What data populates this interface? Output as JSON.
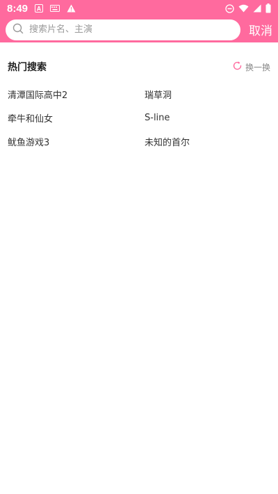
{
  "status_bar": {
    "time": "8:49",
    "icons": [
      "text-a-icon",
      "keyboard-icon",
      "warning-icon",
      "do-not-disturb-icon",
      "wifi-icon",
      "signal-icon",
      "battery-icon"
    ]
  },
  "search": {
    "placeholder": "搜索片名、主演",
    "value": "",
    "cancel_label": "取消"
  },
  "hot_search": {
    "title": "热门搜索",
    "refresh_label": "换一换",
    "items": [
      "清潭国际高中2",
      "瑞草洞",
      "牵牛和仙女",
      "S-line",
      "鱿鱼游戏3",
      "未知的首尔"
    ]
  },
  "colors": {
    "brand": "#ff6a9e",
    "refresh_icon": "#ff6a9e"
  }
}
